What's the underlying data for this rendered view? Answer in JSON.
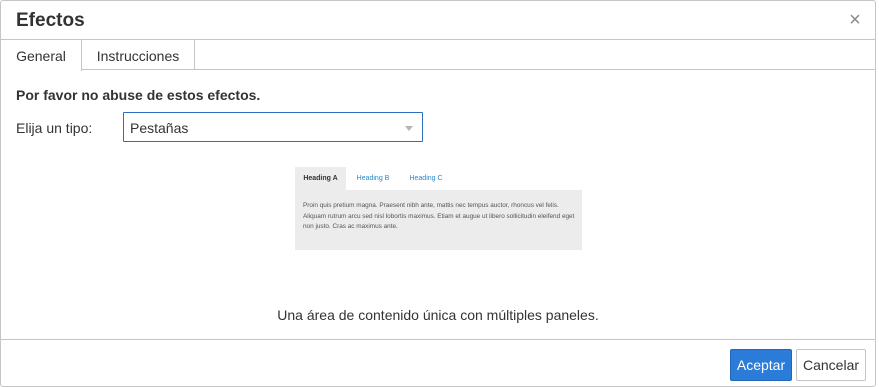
{
  "dialog": {
    "title": "Efectos",
    "close_icon": "close-icon"
  },
  "tabs": [
    {
      "label": "General",
      "active": true
    },
    {
      "label": "Instrucciones",
      "active": false
    }
  ],
  "general": {
    "warning": "Por favor no abuse de estos efectos.",
    "type_label": "Elija un tipo:",
    "type_value": "Pestañas",
    "preview": {
      "tabs": [
        "Heading A",
        "Heading B",
        "Heading C"
      ],
      "body": "Proin quis pretium magna. Praesent nibh ante, mattis nec tempus auctor, rhoncus vel felis. Aliquam rutrum arcu sed nisl lobortis maximus. Etiam et augue ut libero sollicitudin eleifend eget non justo. Cras ac maximus ante."
    },
    "description": "Una área de contenido única con múltiples paneles."
  },
  "footer": {
    "accept_label": "Aceptar",
    "cancel_label": "Cancelar"
  },
  "colors": {
    "accent": "#2b7bd8",
    "link": "#2b87c7",
    "border": "#c5c5c5"
  }
}
